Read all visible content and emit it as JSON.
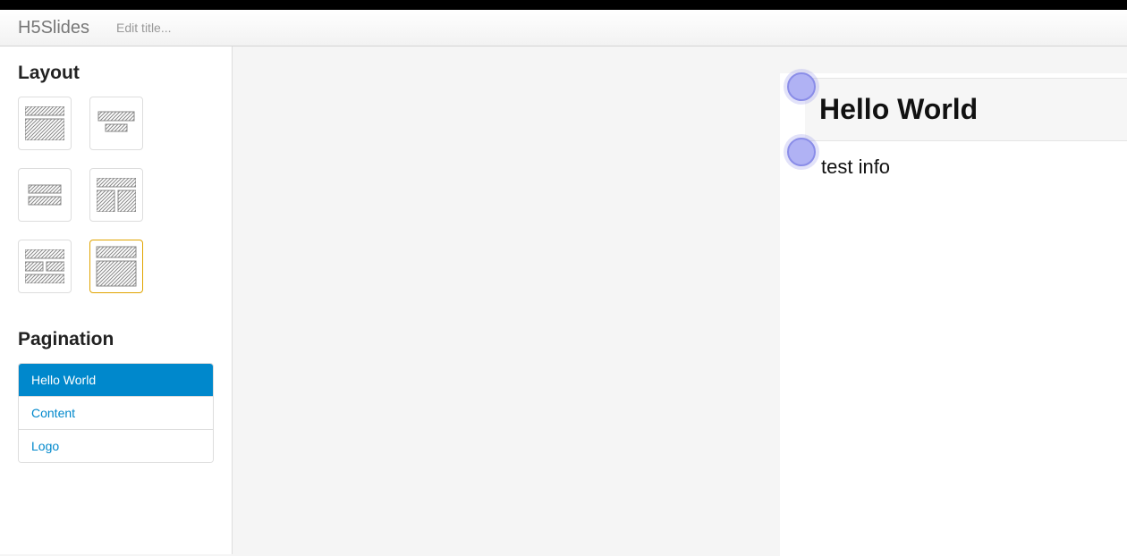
{
  "navbar": {
    "brand": "H5Slides",
    "title_placeholder": "Edit title..."
  },
  "sidebar": {
    "layout_heading": "Layout",
    "pagination_heading": "Pagination",
    "layouts": [
      {
        "id": "layout-title-content",
        "selected": false
      },
      {
        "id": "layout-title-subtitle",
        "selected": false
      },
      {
        "id": "layout-two-rows",
        "selected": false
      },
      {
        "id": "layout-title-two-col",
        "selected": false
      },
      {
        "id": "layout-title-split",
        "selected": false
      },
      {
        "id": "layout-full-content",
        "selected": true
      }
    ],
    "pages": [
      {
        "label": "Hello World",
        "active": true
      },
      {
        "label": "Content",
        "active": false
      },
      {
        "label": "Logo",
        "active": false
      }
    ]
  },
  "slide": {
    "title": "Hello World",
    "body": "test info"
  }
}
